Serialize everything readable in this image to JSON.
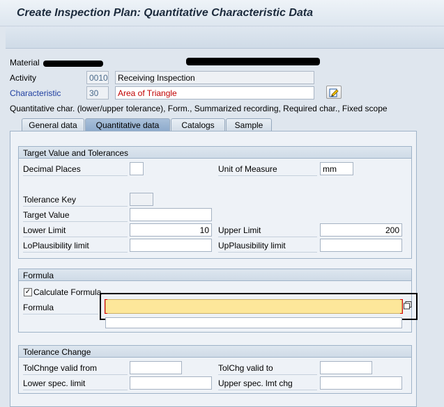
{
  "window": {
    "title": "Create Inspection Plan: Quantitative Characteristic Data"
  },
  "header": {
    "material_label": "Material",
    "activity_label": "Activity",
    "activity_value": "0010",
    "activity_desc": "Receiving Inspection",
    "characteristic_label": "Characteristic",
    "characteristic_value": "30",
    "characteristic_desc": "Area of Triangle",
    "control_indicators": "Quantitative char. (lower/upper tolerance), Form., Summarized recording, Required char., Fixed scope"
  },
  "tabs": [
    {
      "label": "General data",
      "active": false
    },
    {
      "label": "Quantitative data",
      "active": true
    },
    {
      "label": "Catalogs",
      "active": false
    },
    {
      "label": "Sample",
      "active": false
    }
  ],
  "target_group": {
    "title": "Target Value and Tolerances",
    "decimal_places_label": "Decimal Places",
    "decimal_places_value": "",
    "unit_label": "Unit of Measure",
    "unit_value": "mm",
    "tolerance_key_label": "Tolerance Key",
    "target_value_label": "Target Value",
    "lower_limit_label": "Lower Limit",
    "lower_limit_value": "10",
    "upper_limit_label": "Upper Limit",
    "upper_limit_value": "200",
    "lo_plaus_label": "LoPlausibility limit",
    "up_plaus_label": "UpPlausibility limit"
  },
  "formula_group": {
    "title": "Formula",
    "calc_label": "Calculate Formula",
    "calc_checked": "✓",
    "formula_label": "Formula",
    "formula_value": ""
  },
  "tolerance_change_group": {
    "title": "Tolerance Change",
    "tol_valid_from_label": "TolChnge valid from",
    "tol_valid_to_label": "TolChg valid to",
    "lower_spec_label": "Lower spec. limit",
    "upper_spec_label": "Upper spec. lmt chg"
  },
  "icons": {
    "edit": "edit-pencil-icon",
    "copy": "copy-icon"
  }
}
